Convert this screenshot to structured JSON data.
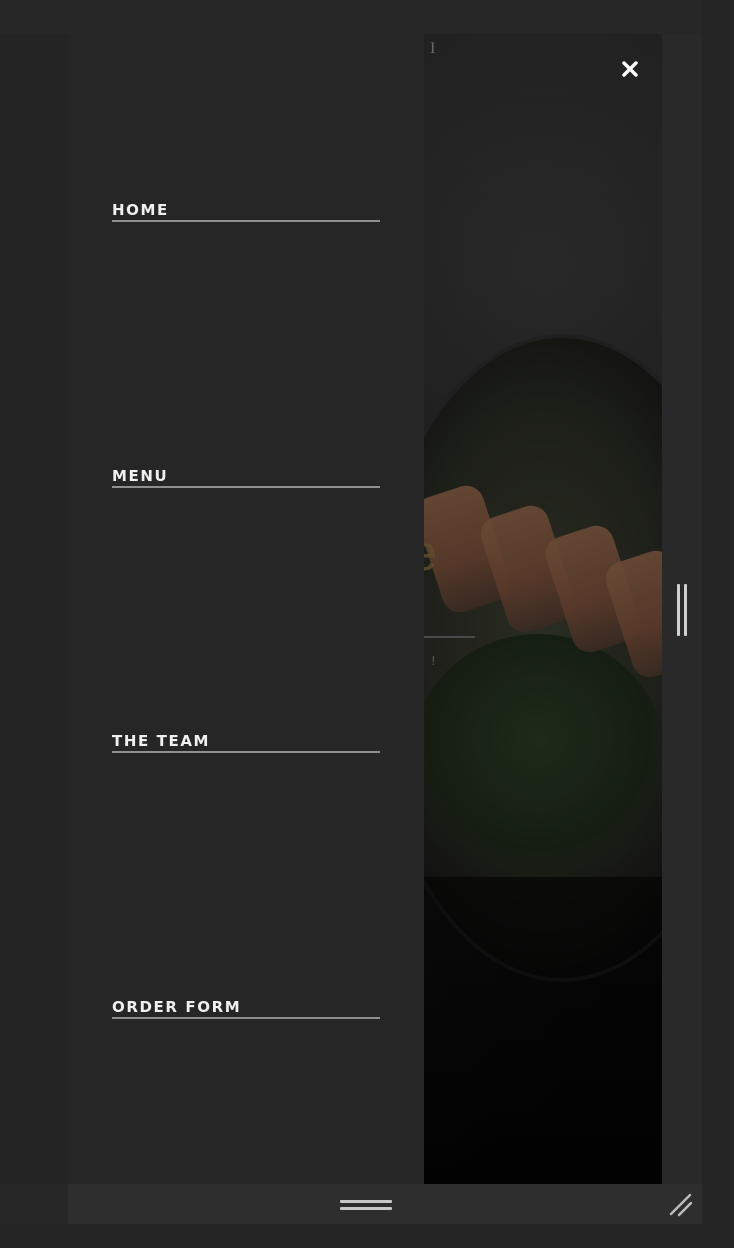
{
  "nav": {
    "items": [
      {
        "label": "HOME"
      },
      {
        "label": "MENU"
      },
      {
        "label": "THE TEAM"
      },
      {
        "label": "ORDER FORM"
      }
    ]
  },
  "hero": {
    "title_fragment": "me",
    "mark": "I",
    "tick": "!"
  },
  "icons": {
    "close": "close-icon",
    "side_handle": "vertical-handle-icon",
    "drag_handle": "horizontal-drag-handle-icon",
    "resize": "resize-grip-icon"
  },
  "colors": {
    "panel_bg": "#262626",
    "nav_text": "#f0f0f0",
    "nav_underline": "#8f8f8f",
    "close_icon": "#ffffff"
  }
}
